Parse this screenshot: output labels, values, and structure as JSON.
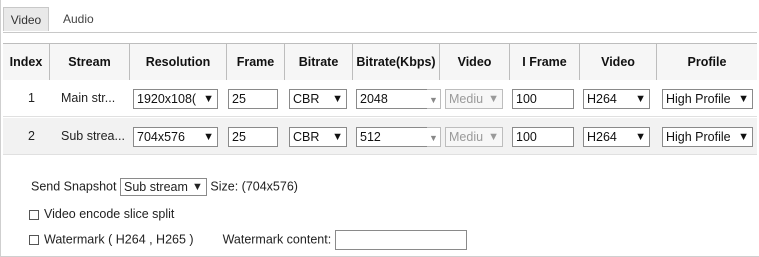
{
  "tabs": [
    {
      "label": "Video",
      "active": true
    },
    {
      "label": "Audio",
      "active": false
    }
  ],
  "table": {
    "headers": [
      "Index",
      "Stream",
      "Resolution",
      "Frame",
      "Bitrate",
      "Bitrate(Kbps)",
      "Video",
      "I Frame",
      "Video",
      "Profile"
    ],
    "rows": [
      {
        "index": "1",
        "stream": "Main str...",
        "resolution": "1920x108(",
        "frame": "25",
        "bitrate_type": "CBR",
        "bitrate_kbps": "2048",
        "video_quality": "Mediu",
        "i_frame": "100",
        "encoding": "H264",
        "profile": "High Profile"
      },
      {
        "index": "2",
        "stream": "Sub strea...",
        "resolution": "704x576",
        "frame": "25",
        "bitrate_type": "CBR",
        "bitrate_kbps": "512",
        "video_quality": "Mediu",
        "i_frame": "100",
        "encoding": "H264",
        "profile": "High Profile"
      }
    ]
  },
  "snapshot": {
    "label": "Send Snapshot",
    "selected": "Sub stream",
    "size_text": "Size: (704x576)"
  },
  "options": {
    "slice_split_label": "Video encode slice split",
    "watermark_label": "Watermark ( H264 , H265 )",
    "watermark_content_label": "Watermark content:",
    "watermark_content_value": ""
  },
  "icons": {
    "dropdown": "chevron-down-icon",
    "checkbox": "checkbox-unchecked-icon"
  }
}
